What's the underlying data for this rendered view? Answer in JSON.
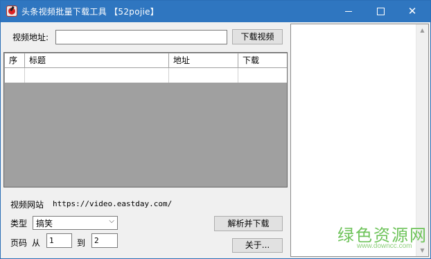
{
  "window": {
    "title": "头条视频批量下载工具 【52pojie】",
    "controls": {
      "minimize": "",
      "maximize": "",
      "close": "✕"
    }
  },
  "url_row": {
    "label": "视频地址:",
    "input_value": "",
    "download_button": "下载视频"
  },
  "table": {
    "columns": [
      "序",
      "标题",
      "地址",
      "下载"
    ],
    "rows": [
      [
        "",
        "",
        "",
        ""
      ]
    ]
  },
  "site_row": {
    "label": "视频网站",
    "url": "https://video.eastday.com/"
  },
  "type_row": {
    "label": "类型",
    "selected": "搞笑"
  },
  "page_row": {
    "label": "页码",
    "from_label": "从",
    "from_value": "1",
    "to_label": "到",
    "to_value": "2"
  },
  "buttons": {
    "parse": "解析并下载",
    "about": "关于..."
  },
  "watermark": {
    "main": "绿色资源网",
    "sub": "www.downcc.com"
  },
  "colors": {
    "titlebar": "#2f76c0",
    "grid_bg": "#a0a0a0",
    "watermark": "#6ec35a"
  }
}
